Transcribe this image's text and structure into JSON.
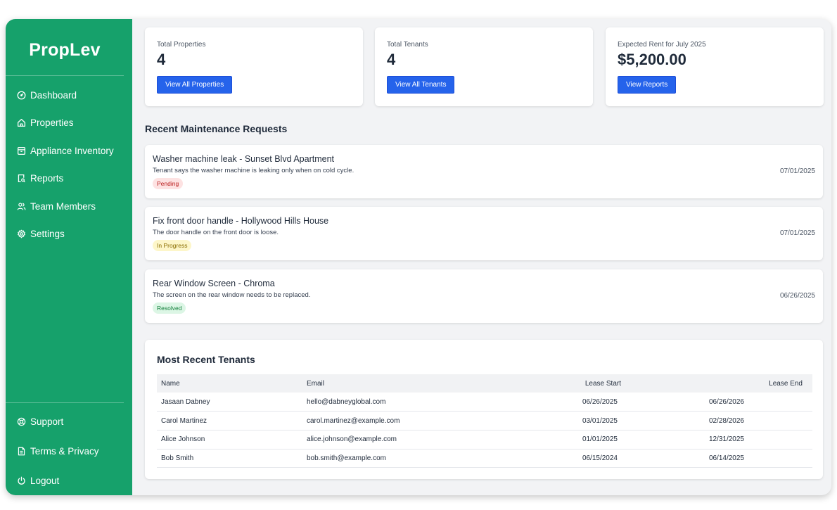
{
  "app": {
    "name": "PropLev"
  },
  "sidebar": {
    "items": [
      {
        "label": "Dashboard",
        "icon": "dashboard-icon"
      },
      {
        "label": "Properties",
        "icon": "home-icon"
      },
      {
        "label": "Appliance Inventory",
        "icon": "archive-icon"
      },
      {
        "label": "Reports",
        "icon": "report-search-icon"
      },
      {
        "label": "Team Members",
        "icon": "users-icon"
      },
      {
        "label": "Settings",
        "icon": "gear-icon"
      }
    ],
    "footer": [
      {
        "label": "Support",
        "icon": "lifebuoy-icon"
      },
      {
        "label": "Terms & Privacy",
        "icon": "document-icon"
      },
      {
        "label": "Logout",
        "icon": "power-icon"
      }
    ]
  },
  "stats": [
    {
      "label": "Total Properties",
      "value": "4",
      "button": "View All Properties"
    },
    {
      "label": "Total Tenants",
      "value": "4",
      "button": "View All Tenants"
    },
    {
      "label": "Expected Rent for July 2025",
      "value": "$5,200.00",
      "button": "View Reports"
    }
  ],
  "maintenance": {
    "title": "Recent Maintenance Requests",
    "requests": [
      {
        "title": "Washer machine leak - Sunset Blvd Apartment",
        "description": "Tenant says the washer machine is leaking only when on cold cycle.",
        "status": "Pending",
        "date": "07/01/2025"
      },
      {
        "title": "Fix front door handle - Hollywood Hills House",
        "description": "The door handle on the front door is loose.",
        "status": "In Progress",
        "date": "07/01/2025"
      },
      {
        "title": "Rear Window Screen - Chroma",
        "description": "The screen on the rear window needs to be replaced.",
        "status": "Resolved",
        "date": "06/26/2025"
      }
    ]
  },
  "tenants": {
    "title": "Most Recent Tenants",
    "columns": [
      "Name",
      "Email",
      "Lease Start",
      "Lease End"
    ],
    "rows": [
      [
        "Jasaan Dabney",
        "hello@dabneyglobal.com",
        "06/26/2025",
        "06/26/2026"
      ],
      [
        "Carol Martinez",
        "carol.martinez@example.com",
        "03/01/2025",
        "02/28/2026"
      ],
      [
        "Alice Johnson",
        "alice.johnson@example.com",
        "01/01/2025",
        "12/31/2025"
      ],
      [
        "Bob Smith",
        "bob.smith@example.com",
        "06/15/2024",
        "06/14/2025"
      ]
    ]
  },
  "colors": {
    "sidebar": "#16a16b",
    "primary": "#2563eb",
    "background": "#f2f3f5"
  }
}
